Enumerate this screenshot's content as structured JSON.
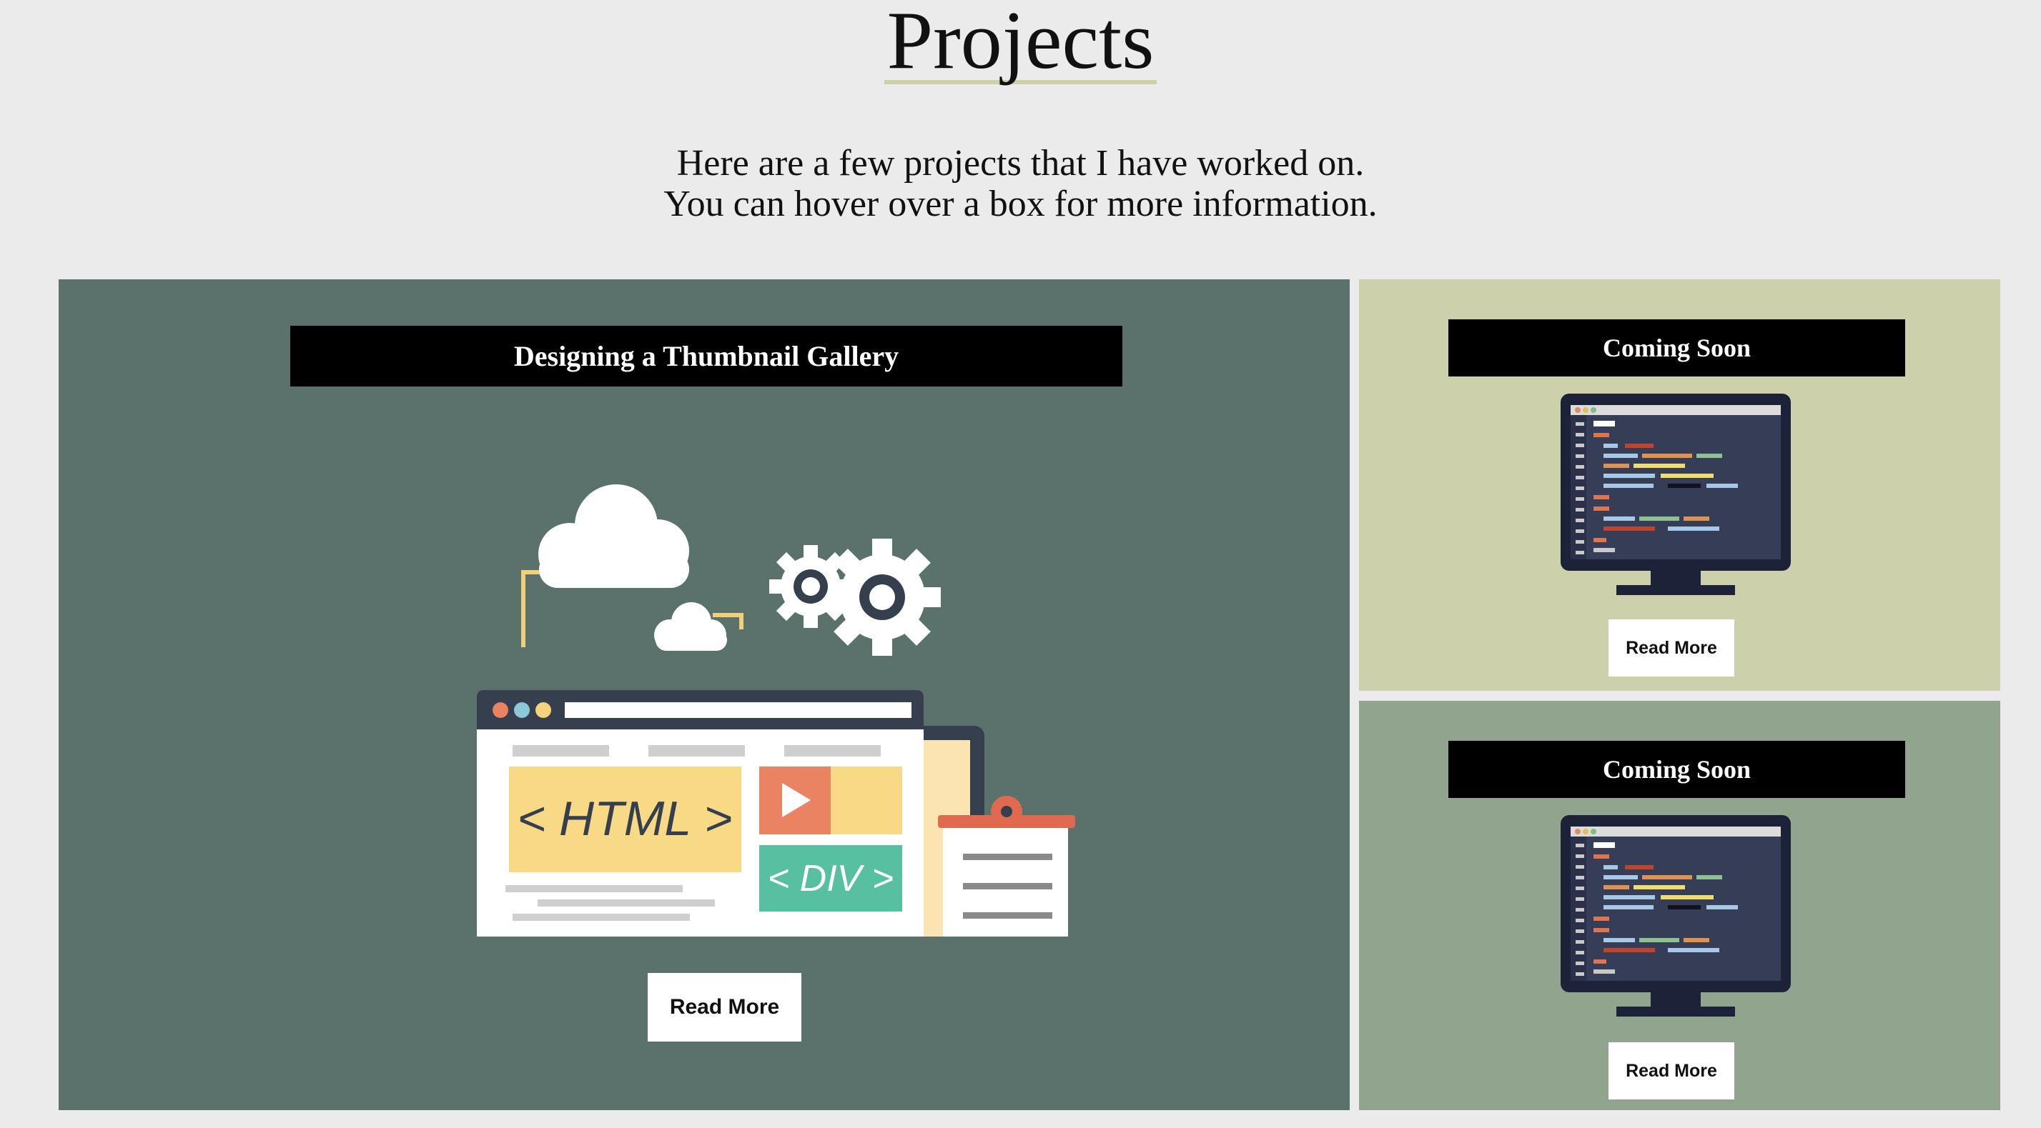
{
  "header": {
    "title": "Projects"
  },
  "intro": {
    "line1": "Here are a few projects that I have worked on.",
    "line2": "You can hover over a box for more information."
  },
  "projects": [
    {
      "label": "Designing a Thumbnail Gallery",
      "button": "Read More",
      "image": "web-design-illustration"
    },
    {
      "label": "Coming Soon",
      "button": "Read More",
      "image": "code-monitor-icon"
    },
    {
      "label": "Coming Soon",
      "button": "Read More",
      "image": "code-monitor-icon"
    }
  ],
  "illustration_text": {
    "html_tag": "< HTML >",
    "div_tag": "< DIV >"
  },
  "colors": {
    "background": "#ebebeb",
    "panel_main": "#5b716c",
    "panel_top": "#cdd1ab",
    "panel_bottom": "#91a58e",
    "title_underline": "#cdd1ab"
  }
}
